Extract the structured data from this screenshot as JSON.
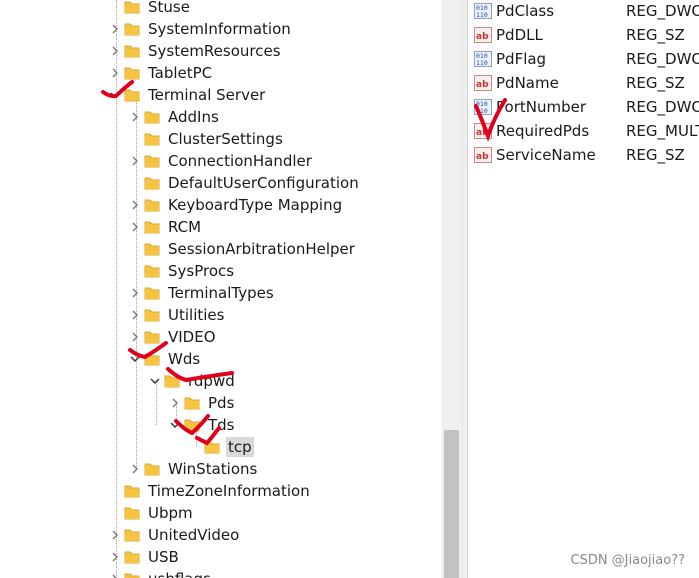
{
  "tree": {
    "nodes": [
      {
        "label": "Stuse"
      },
      {
        "label": "SystemInformation"
      },
      {
        "label": "SystemResources"
      },
      {
        "label": "TabletPC"
      },
      {
        "label": "Terminal Server"
      },
      {
        "label": "AddIns"
      },
      {
        "label": "ClusterSettings"
      },
      {
        "label": "ConnectionHandler"
      },
      {
        "label": "DefaultUserConfiguration"
      },
      {
        "label": "KeyboardType Mapping"
      },
      {
        "label": "RCM"
      },
      {
        "label": "SessionArbitrationHelper"
      },
      {
        "label": "SysProcs"
      },
      {
        "label": "TerminalTypes"
      },
      {
        "label": "Utilities"
      },
      {
        "label": "VIDEO"
      },
      {
        "label": "Wds"
      },
      {
        "label": "rdpwd"
      },
      {
        "label": "Pds"
      },
      {
        "label": "Tds"
      },
      {
        "label": "tcp"
      },
      {
        "label": "WinStations"
      },
      {
        "label": "TimeZoneInformation"
      },
      {
        "label": "Ubpm"
      },
      {
        "label": "UnitedVideo"
      },
      {
        "label": "USB"
      },
      {
        "label": "usbflags"
      }
    ]
  },
  "values": {
    "rows": [
      {
        "name": "PdClass",
        "type": "REG_DWORD",
        "icon": "binary-value-icon"
      },
      {
        "name": "PdDLL",
        "type": "REG_SZ",
        "icon": "string-value-icon"
      },
      {
        "name": "PdFlag",
        "type": "REG_DWORD",
        "icon": "binary-value-icon"
      },
      {
        "name": "PdName",
        "type": "REG_SZ",
        "icon": "string-value-icon"
      },
      {
        "name": "PortNumber",
        "type": "REG_DWORD",
        "icon": "binary-value-icon"
      },
      {
        "name": "RequiredPds",
        "type": "REG_MULTI_SZ",
        "icon": "string-value-icon"
      },
      {
        "name": "ServiceName",
        "type": "REG_SZ",
        "icon": "string-value-icon"
      }
    ]
  },
  "watermark": "CSDN @Jiaojiao??",
  "colors": {
    "folder": "#f5c542",
    "folder_dark": "#dca531",
    "annotation": "#e1001c",
    "selection": "#d9d9d9"
  }
}
